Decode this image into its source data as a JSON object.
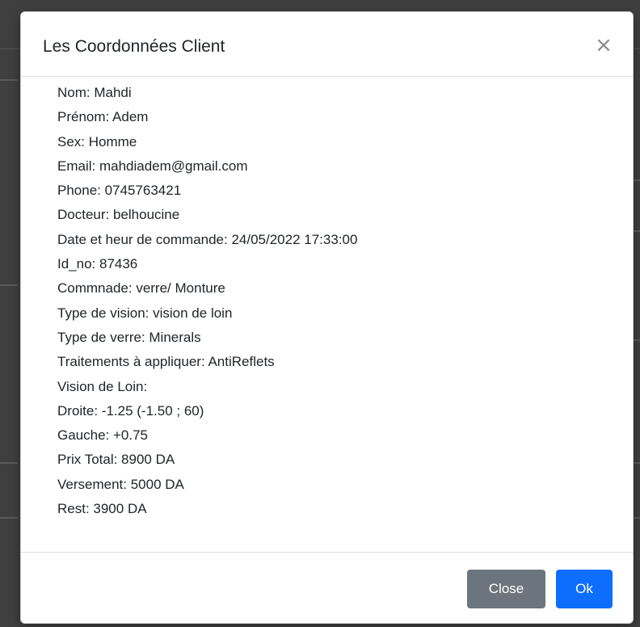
{
  "modal": {
    "title": "Les Coordonnées Client",
    "close_icon": "×",
    "fields": [
      "Nom: Mahdi",
      "Prénom: Adem",
      "Sex: Homme",
      "Email: mahdiadem@gmail.com",
      "Phone: 0745763421",
      "Docteur: belhoucine",
      "Date et heur de commande: 24/05/2022 17:33:00",
      "Id_no: 87436",
      "Commnade: verre/ Monture",
      "Type de vision: vision de loin",
      "Type de verre: Minerals",
      "Traitements à appliquer: AntiReflets",
      "Vision de Loin:",
      "Droite: -1.25 (-1.50 ; 60)",
      "Gauche: +0.75",
      "Prix Total: 8900 DA",
      "Versement: 5000 DA",
      "Rest: 3900 DA"
    ],
    "footer": {
      "close_label": "Close",
      "ok_label": "Ok"
    }
  },
  "colors": {
    "close_button": "#6c757d",
    "ok_button": "#0d6efd",
    "backdrop": "#4a4a4a"
  }
}
